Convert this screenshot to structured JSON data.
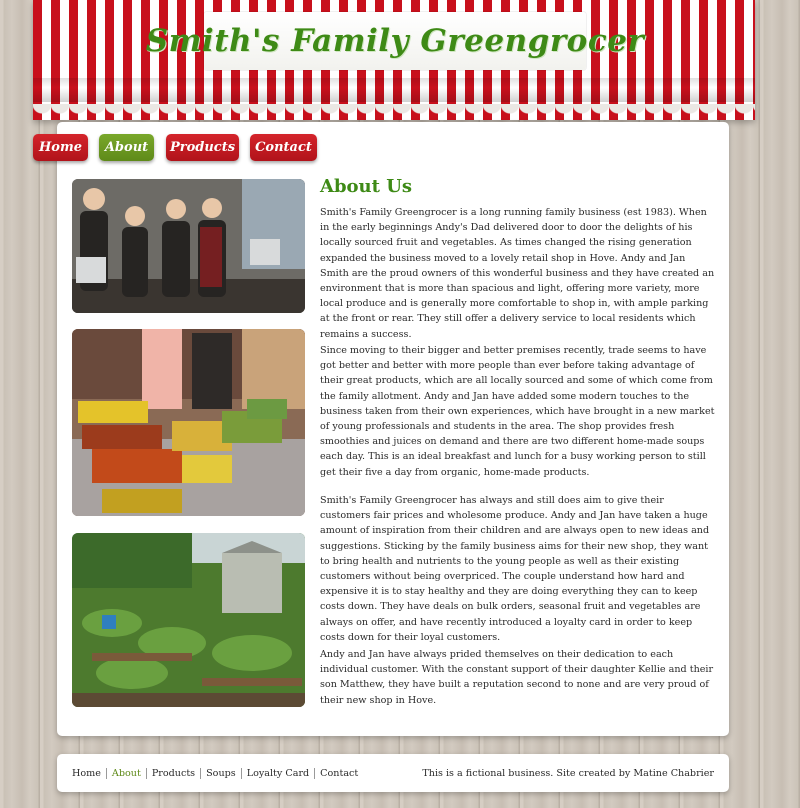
{
  "header": {
    "title": "Smith's Family Greengrocer"
  },
  "nav": {
    "items": [
      {
        "label": "Home",
        "active": false
      },
      {
        "label": "About",
        "active": true
      },
      {
        "label": "Products",
        "active": false
      },
      {
        "label": "Contact",
        "active": false
      }
    ]
  },
  "colors": {
    "accent_green": "#3e8a16",
    "nav_red": "#c8101c",
    "nav_active_green": "#6b9a22"
  },
  "main": {
    "heading": "About Us",
    "paragraphs": [
      "Smith's Family Greengrocer is a long running family business (est 1983). When in the early beginnings Andy's Dad delivered door to door the delights of his locally sourced fruit and vegetables. As times changed the rising generation expanded the business moved to a lovely retail shop in Hove. Andy and Jan Smith are the proud owners of this wonderful business and they have created an environment that is more than spacious and light, offering more variety, more local produce and is generally more comfortable to shop in, with ample parking at the front or rear. They still offer a delivery service to local residents which remains a success.",
      "Since moving to their bigger and better premises recently, trade seems to have got better and better with more people than ever before taking advantage of their great products, which are all locally sourced and some of which come from the family allotment. Andy and Jan have added some modern touches to the business taken from their own experiences, which have brought in a new market of young professionals and students in the area. The shop provides fresh smoothies and juices on demand and there are two different home-made soups each day. This is an ideal breakfast and lunch for a busy working person to still get their five a day from organic, home-made products.",
      "Smith's Family Greengrocer has always and still does aim to give their customers fair prices and wholesome produce. Andy and Jan have taken a huge amount of inspiration from their children and are always open to new ideas and suggestions. Sticking by the family business aims for their new shop, they want to bring health and nutrients to the young people as well as their existing customers without being overpriced. The couple understand how hard and expensive it is to stay healthy and they are doing everything they can to keep costs down. They have deals on bulk orders, seasonal fruit and vegetables are always on offer, and have recently introduced a loyalty card in order to keep costs down for their loyal customers.",
      "Andy and Jan have always prided themselves on their dedication to each individual customer. With the constant support of their daughter Kellie and their son Matthew, they have built a reputation second to none and are very proud of their new shop in Hove."
    ]
  },
  "footer": {
    "links": [
      {
        "label": "Home",
        "active": false
      },
      {
        "label": "About",
        "active": true
      },
      {
        "label": "Products",
        "active": false
      },
      {
        "label": "Soups",
        "active": false
      },
      {
        "label": "Loyalty Card",
        "active": false
      },
      {
        "label": "Contact",
        "active": false
      }
    ],
    "credit": "This is a fictional business. Site created by Matine Chabrier"
  }
}
